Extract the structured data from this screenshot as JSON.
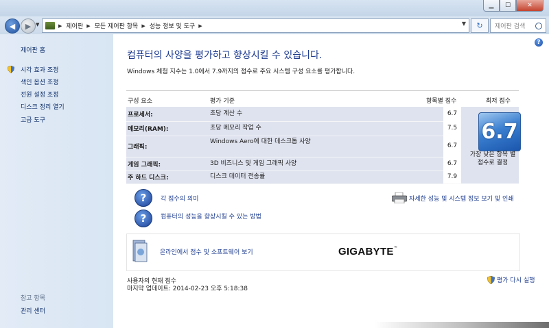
{
  "window": {
    "min": "▁",
    "max": "☐",
    "close": "✕"
  },
  "address": {
    "crumbs": [
      "제어판",
      "모든 제어판 항목",
      "성능 정보 및 도구"
    ],
    "search_placeholder": "제어판 검색"
  },
  "sidebar": {
    "home": "제어판 홈",
    "links": [
      "시각 효과 조정",
      "색인 옵션 조정",
      "전원 설정 조정",
      "디스크 정리 열기",
      "고급 도구"
    ],
    "see_also_header": "참고 항목",
    "see_also_links": [
      "관리 센터"
    ]
  },
  "main": {
    "title": "컴퓨터의 사양을 평가하고 향상시킬 수 있습니다.",
    "description": "Windows 체험 지수는 1.0에서 7.9까지의 점수로 주요 시스템 구성 요소를 평가합니다.",
    "table": {
      "headers": [
        "구성 요소",
        "평가 기준",
        "항목별 점수",
        "최저 점수"
      ],
      "rows": [
        {
          "component": "프로세서:",
          "criteria": "초당 계산 수",
          "score": "6.7"
        },
        {
          "component": "메모리(RAM):",
          "criteria": "초당 메모리 작업 수",
          "score": "7.5"
        },
        {
          "component": "그래픽:",
          "criteria": "Windows Aero에 대한 데스크톱 사양",
          "score": "6.7"
        },
        {
          "component": "게임 그래픽:",
          "criteria": "3D 비즈니스 및 게임 그래픽 사양",
          "score": "6.7"
        },
        {
          "component": "주 하드 디스크:",
          "criteria": "디스크 데이터 전송률",
          "score": "7.9"
        }
      ],
      "base_score": "6.7",
      "base_caption": "가장 낮은 항목 별 점수로 결정"
    },
    "links": {
      "score_meaning": "각 점수의 의미",
      "improve": "컴퓨터의 성능을 향상시킬 수 있는 방법",
      "details": "자세한 성능 및 시스템 정보 보기 및 인쇄",
      "online": "온라인에서 점수 및 소프트웨어 보기",
      "rerun": "평가 다시 실행"
    },
    "brand": "GIGABYTE",
    "brand_tm": "™",
    "status_label": "사용자의 현재 점수",
    "last_update": "마지막 업데이트: 2014-02-23 오후 5:18:38"
  }
}
